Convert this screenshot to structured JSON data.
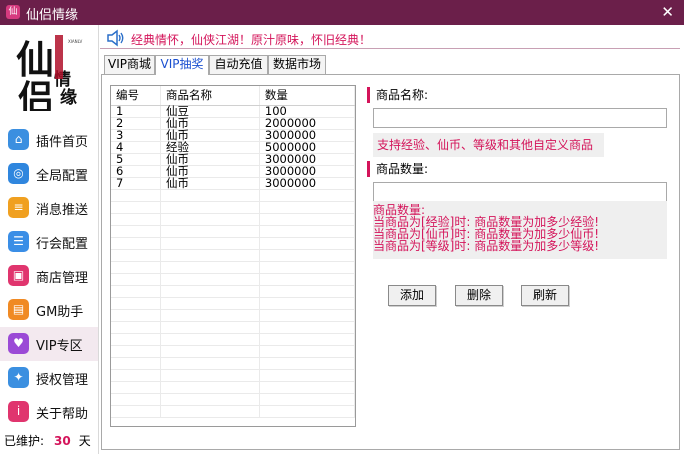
{
  "window": {
    "title": "仙侣情缘",
    "close_glyph": "✕"
  },
  "logo": {
    "text": "仙侣情缘",
    "subtitle": "XIANLV QINGYUAN"
  },
  "sidebar": {
    "items": [
      {
        "label": "插件首页",
        "icon": "home-icon",
        "color": "#3b8fe0",
        "glyph": "⌂"
      },
      {
        "label": "全局配置",
        "icon": "settings-icon",
        "color": "#2f86de",
        "glyph": "◎"
      },
      {
        "label": "消息推送",
        "icon": "message-icon",
        "color": "#f0a020",
        "glyph": "≡"
      },
      {
        "label": "行会配置",
        "icon": "layers-icon",
        "color": "#3a8ee6",
        "glyph": "☰"
      },
      {
        "label": "商店管理",
        "icon": "shop-icon",
        "color": "#e0356e",
        "glyph": "▣"
      },
      {
        "label": "GM助手",
        "icon": "briefcase-icon",
        "color": "#f08a24",
        "glyph": "▤"
      },
      {
        "label": "VIP专区",
        "icon": "vip-icon",
        "color": "#9b4ad6",
        "glyph": "♥"
      },
      {
        "label": "授权管理",
        "icon": "gear-icon",
        "color": "#3b8fe0",
        "glyph": "✦"
      },
      {
        "label": "关于帮助",
        "icon": "info-icon",
        "color": "#e0356e",
        "glyph": "i"
      }
    ],
    "active_index": 6,
    "maintain": {
      "prefix": "已维护:",
      "days": "30",
      "unit": "天"
    }
  },
  "announcement": "经典情怀，仙侠江湖！原汁原味，怀旧经典！",
  "tabs": [
    {
      "label": "VIP商城"
    },
    {
      "label": "VIP抽奖"
    },
    {
      "label": "自动充值"
    },
    {
      "label": "数据市场"
    }
  ],
  "active_tab": 1,
  "table": {
    "headers": [
      "编号",
      "商品名称",
      "数量"
    ],
    "rows": [
      [
        "1",
        "仙豆",
        "100"
      ],
      [
        "2",
        "仙币",
        "2000000"
      ],
      [
        "3",
        "仙币",
        "3000000"
      ],
      [
        "4",
        "经验",
        "5000000"
      ],
      [
        "5",
        "仙币",
        "3000000"
      ],
      [
        "6",
        "仙币",
        "3000000"
      ],
      [
        "7",
        "仙币",
        "3000000"
      ]
    ],
    "empty_rows": 19
  },
  "form": {
    "name_label": "商品名称:",
    "name_value": "",
    "name_hint": "支持经验、仙币、等级和其他自定义商品",
    "qty_label": "商品数量:",
    "qty_value": "",
    "qty_hint_lines": [
      "商品数量:",
      "当商品为[经验]时: 商品数量为加多少经验!",
      "当商品为[仙币]时: 商品数量为加多少仙币!",
      "当商品为[等级]时: 商品数量为加多少等级!"
    ]
  },
  "buttons": {
    "add": "添加",
    "delete": "删除",
    "refresh": "刷新"
  },
  "colors": {
    "titlebar": "#6b1f4a",
    "accent": "#d4145a",
    "tab_active_text": "#1a4fd0"
  }
}
